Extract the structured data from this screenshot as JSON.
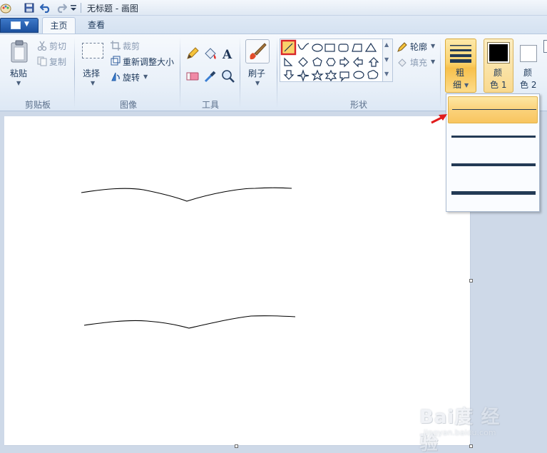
{
  "window": {
    "title": "无标题 - 画图"
  },
  "quick_access": {
    "icons": [
      "paint-app-icon",
      "save-icon",
      "undo-icon",
      "redo-icon",
      "customize-qat-icon"
    ]
  },
  "tabs": [
    {
      "label": "主页",
      "active": true
    },
    {
      "label": "查看",
      "active": false
    }
  ],
  "ribbon": {
    "clipboard": {
      "group_label": "剪贴板",
      "paste": "粘贴",
      "cut": "剪切",
      "copy": "复制"
    },
    "image": {
      "group_label": "图像",
      "select": "选择",
      "crop": "裁剪",
      "resize": "重新调整大小",
      "rotate": "旋转"
    },
    "tools": {
      "group_label": "工具"
    },
    "brushes": {
      "label": "刷子"
    },
    "shapes": {
      "group_label": "形状",
      "outline": "轮廓",
      "fill": "填充",
      "selected_shape": "line"
    },
    "size": {
      "label_line1": "粗",
      "label_line2": "细"
    },
    "color1": {
      "label_line1": "颜",
      "label_line2": "色 1",
      "value": "#000000"
    },
    "color2": {
      "label_line1": "颜",
      "label_line2": "色 2",
      "value": "#ffffff"
    }
  },
  "size_dropdown": {
    "selected_index": 0,
    "options": [
      {
        "weight": "1px"
      },
      {
        "weight": "3px"
      },
      {
        "weight": "5px"
      },
      {
        "weight": "8px"
      }
    ]
  },
  "watermark": {
    "brand": "Bai度 经验",
    "url": "jingyan.baidu.com"
  },
  "colors": {
    "accent": "#fbd26d",
    "file_button": "#2b62b1",
    "annotation_arrow": "#e11b1b"
  }
}
